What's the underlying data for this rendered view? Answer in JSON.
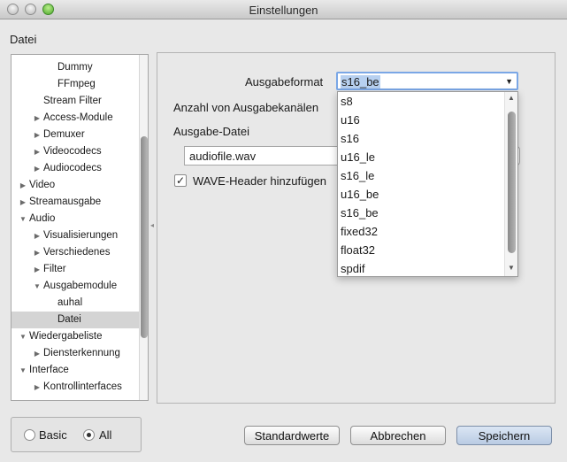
{
  "window": {
    "title": "Einstellungen"
  },
  "section_title": "Datei",
  "tree": {
    "items": [
      {
        "label": "Dummy",
        "expander": false,
        "expanded": false,
        "level": 3,
        "selected": false
      },
      {
        "label": "FFmpeg",
        "expander": false,
        "expanded": false,
        "level": 3,
        "selected": false
      },
      {
        "label": "Stream Filter",
        "expander": false,
        "expanded": false,
        "level": 2,
        "selected": false
      },
      {
        "label": "Access-Module",
        "expander": true,
        "expanded": false,
        "level": 1,
        "selected": false
      },
      {
        "label": "Demuxer",
        "expander": true,
        "expanded": false,
        "level": 1,
        "selected": false
      },
      {
        "label": "Videocodecs",
        "expander": true,
        "expanded": false,
        "level": 1,
        "selected": false
      },
      {
        "label": "Audiocodecs",
        "expander": true,
        "expanded": false,
        "level": 1,
        "selected": false
      },
      {
        "label": "Video",
        "expander": true,
        "expanded": false,
        "level": 0,
        "selected": false
      },
      {
        "label": "Streamausgabe",
        "expander": true,
        "expanded": false,
        "level": 0,
        "selected": false
      },
      {
        "label": "Audio",
        "expander": true,
        "expanded": true,
        "level": 0,
        "selected": false
      },
      {
        "label": "Visualisierungen",
        "expander": true,
        "expanded": false,
        "level": 1,
        "selected": false
      },
      {
        "label": "Verschiedenes",
        "expander": true,
        "expanded": false,
        "level": 1,
        "selected": false
      },
      {
        "label": "Filter",
        "expander": true,
        "expanded": false,
        "level": 1,
        "selected": false
      },
      {
        "label": "Ausgabemodule",
        "expander": true,
        "expanded": true,
        "level": 1,
        "selected": false
      },
      {
        "label": "auhal",
        "expander": false,
        "expanded": false,
        "level": 3,
        "selected": false
      },
      {
        "label": "Datei",
        "expander": false,
        "expanded": false,
        "level": 3,
        "selected": true
      },
      {
        "label": "Wiedergabeliste",
        "expander": true,
        "expanded": true,
        "level": 0,
        "selected": false
      },
      {
        "label": "Diensterkennung",
        "expander": true,
        "expanded": false,
        "level": 1,
        "selected": false
      },
      {
        "label": "Interface",
        "expander": true,
        "expanded": true,
        "level": 0,
        "selected": false
      },
      {
        "label": "Kontrollinterfaces",
        "expander": true,
        "expanded": false,
        "level": 1,
        "selected": false
      }
    ]
  },
  "settings": {
    "format_label": "Ausgabeformat",
    "format_value": "s16_be",
    "channels_label": "Anzahl von Ausgabekanälen",
    "file_label": "Ausgabe-Datei",
    "file_value": "audiofile.wav",
    "wave_header_label": "WAVE-Header hinzufügen",
    "wave_header_checked": "✓"
  },
  "dropdown": {
    "options": [
      "s8",
      "u16",
      "s16",
      "u16_le",
      "s16_le",
      "u16_be",
      "s16_be",
      "fixed32",
      "float32",
      "spdif"
    ]
  },
  "mode": {
    "basic_label": "Basic",
    "all_label": "All",
    "selected": "all"
  },
  "buttons": {
    "reset": "Standardwerte",
    "cancel": "Abbrechen",
    "save": "Speichern"
  },
  "icons": {
    "collapsed": "collapsed-triangle-icon",
    "expanded": "expanded-triangle-icon",
    "dropdown_arrow": "chevron-down-icon",
    "check": "checkmark-icon"
  },
  "colors": {
    "selection": "#b7d0f0",
    "focus_ring": "#7aa7e6",
    "selected_row": "#d4d4d4"
  }
}
